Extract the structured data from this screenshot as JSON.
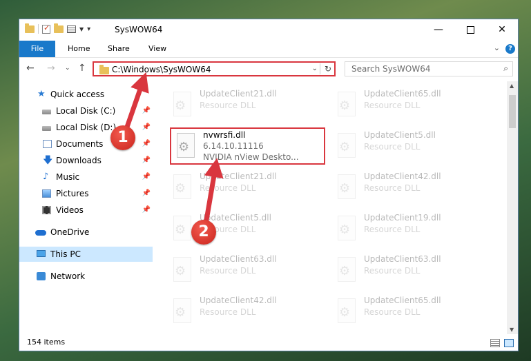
{
  "window": {
    "title": "SysWOW64",
    "controls": {
      "minimize": "—",
      "maximize": "",
      "close": "✕"
    }
  },
  "ribbon": {
    "tabs": [
      "File",
      "Home",
      "Share",
      "View"
    ],
    "help": "?",
    "collapse": "⌄"
  },
  "nav": {
    "back": "←",
    "forward": "→",
    "recent": "⌄",
    "up": "↑",
    "address": "C:\\Windows\\SysWOW64",
    "address_dropdown": "⌄",
    "refresh": "↻",
    "search_placeholder": "Search SysWOW64",
    "search_icon": "⌕"
  },
  "sidebar": {
    "pin": "📌",
    "items": [
      {
        "label": "Quick access",
        "icon": "star-icon"
      },
      {
        "label": "Local Disk (C:)",
        "icon": "drive-icon",
        "pinned": true
      },
      {
        "label": "Local Disk (D:)",
        "icon": "drive-icon",
        "pinned": true
      },
      {
        "label": "Documents",
        "icon": "documents-icon",
        "pinned": true
      },
      {
        "label": "Downloads",
        "icon": "download-icon",
        "pinned": true
      },
      {
        "label": "Music",
        "icon": "music-icon",
        "pinned": true
      },
      {
        "label": "Pictures",
        "icon": "pictures-icon",
        "pinned": true
      },
      {
        "label": "Videos",
        "icon": "videos-icon",
        "pinned": true
      },
      {
        "label": "OneDrive",
        "icon": "cloud-icon"
      },
      {
        "label": "This PC",
        "icon": "computer-icon",
        "selected": true
      },
      {
        "label": "Network",
        "icon": "network-icon"
      }
    ]
  },
  "files": {
    "col1": [
      {
        "name": "UpdateClient21.dll",
        "type": "Resource DLL"
      },
      {
        "name": "nvwrsfi.dll",
        "type": "6.14.10.11116",
        "desc": "NVIDIA nView Deskto...",
        "highlight": true
      },
      {
        "name": "UpdateClient21.dll",
        "type": "Resource DLL"
      },
      {
        "name": "UpdateClient5.dll",
        "type": "Resource DLL"
      },
      {
        "name": "UpdateClient63.dll",
        "type": "Resource DLL"
      },
      {
        "name": "UpdateClient42.dll",
        "type": "Resource DLL"
      }
    ],
    "col2": [
      {
        "name": "UpdateClient65.dll",
        "type": "Resource DLL"
      },
      {
        "name": "UpdateClient5.dll",
        "type": "Resource DLL"
      },
      {
        "name": "UpdateClient42.dll",
        "type": "Resource DLL"
      },
      {
        "name": "UpdateClient19.dll",
        "type": "Resource DLL"
      },
      {
        "name": "UpdateClient63.dll",
        "type": "Resource DLL"
      },
      {
        "name": "UpdateClient65.dll",
        "type": "Resource DLL"
      }
    ]
  },
  "status": {
    "item_count": "154 items"
  },
  "annotations": [
    {
      "label": "1"
    },
    {
      "label": "2"
    }
  ],
  "colors": {
    "accent": "#1979ca",
    "highlight": "#d9363e",
    "selected": "#cce8ff"
  }
}
